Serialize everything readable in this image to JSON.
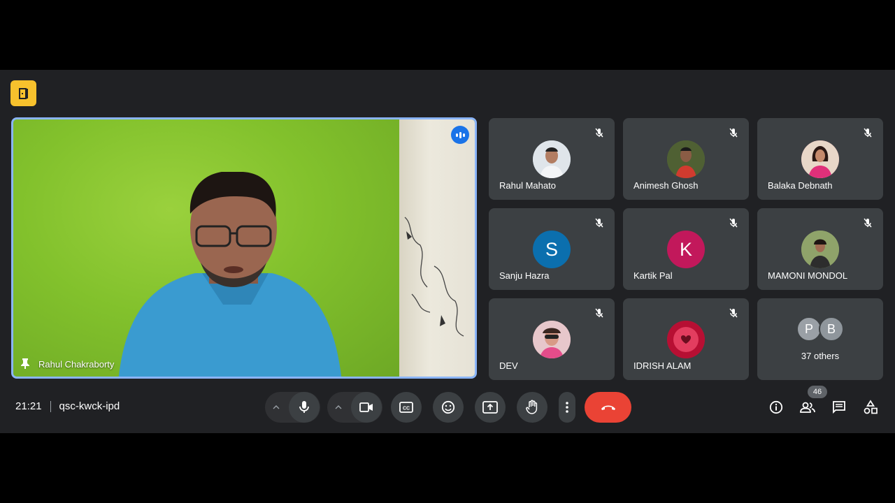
{
  "meeting": {
    "time": "21:21",
    "code": "qsc-kwck-ipd",
    "people_count": "46"
  },
  "presenter": {
    "name": "Rahul Chakraborty"
  },
  "participants": [
    {
      "name": "Rahul Mahato",
      "avatar_type": "photo",
      "avatar_color": "#a7b3be"
    },
    {
      "name": "Animesh Ghosh",
      "avatar_type": "photo",
      "avatar_color": "#5b6b3a"
    },
    {
      "name": "Balaka Debnath",
      "avatar_type": "photo",
      "avatar_color": "#c2456f"
    },
    {
      "name": "Sanju Hazra",
      "avatar_type": "letter",
      "initial": "S",
      "avatar_color": "#0b6fae"
    },
    {
      "name": "Kartik Pal",
      "avatar_type": "letter",
      "initial": "K",
      "avatar_color": "#c2185b"
    },
    {
      "name": "MAMONI MONDOL",
      "avatar_type": "photo",
      "avatar_color": "#7a8a55"
    },
    {
      "name": "DEV",
      "avatar_type": "photo",
      "avatar_color": "#c47f8a"
    },
    {
      "name": "IDRISH ALAM",
      "avatar_type": "photo",
      "avatar_color": "#c4143a"
    }
  ],
  "others": {
    "initials": [
      "P",
      "B"
    ],
    "label": "37 others"
  },
  "colors": {
    "background": "#202124",
    "tile": "#3c4043",
    "end_call": "#ea4335",
    "speaking": "#1a73e8",
    "badge": "#f7c12d"
  }
}
